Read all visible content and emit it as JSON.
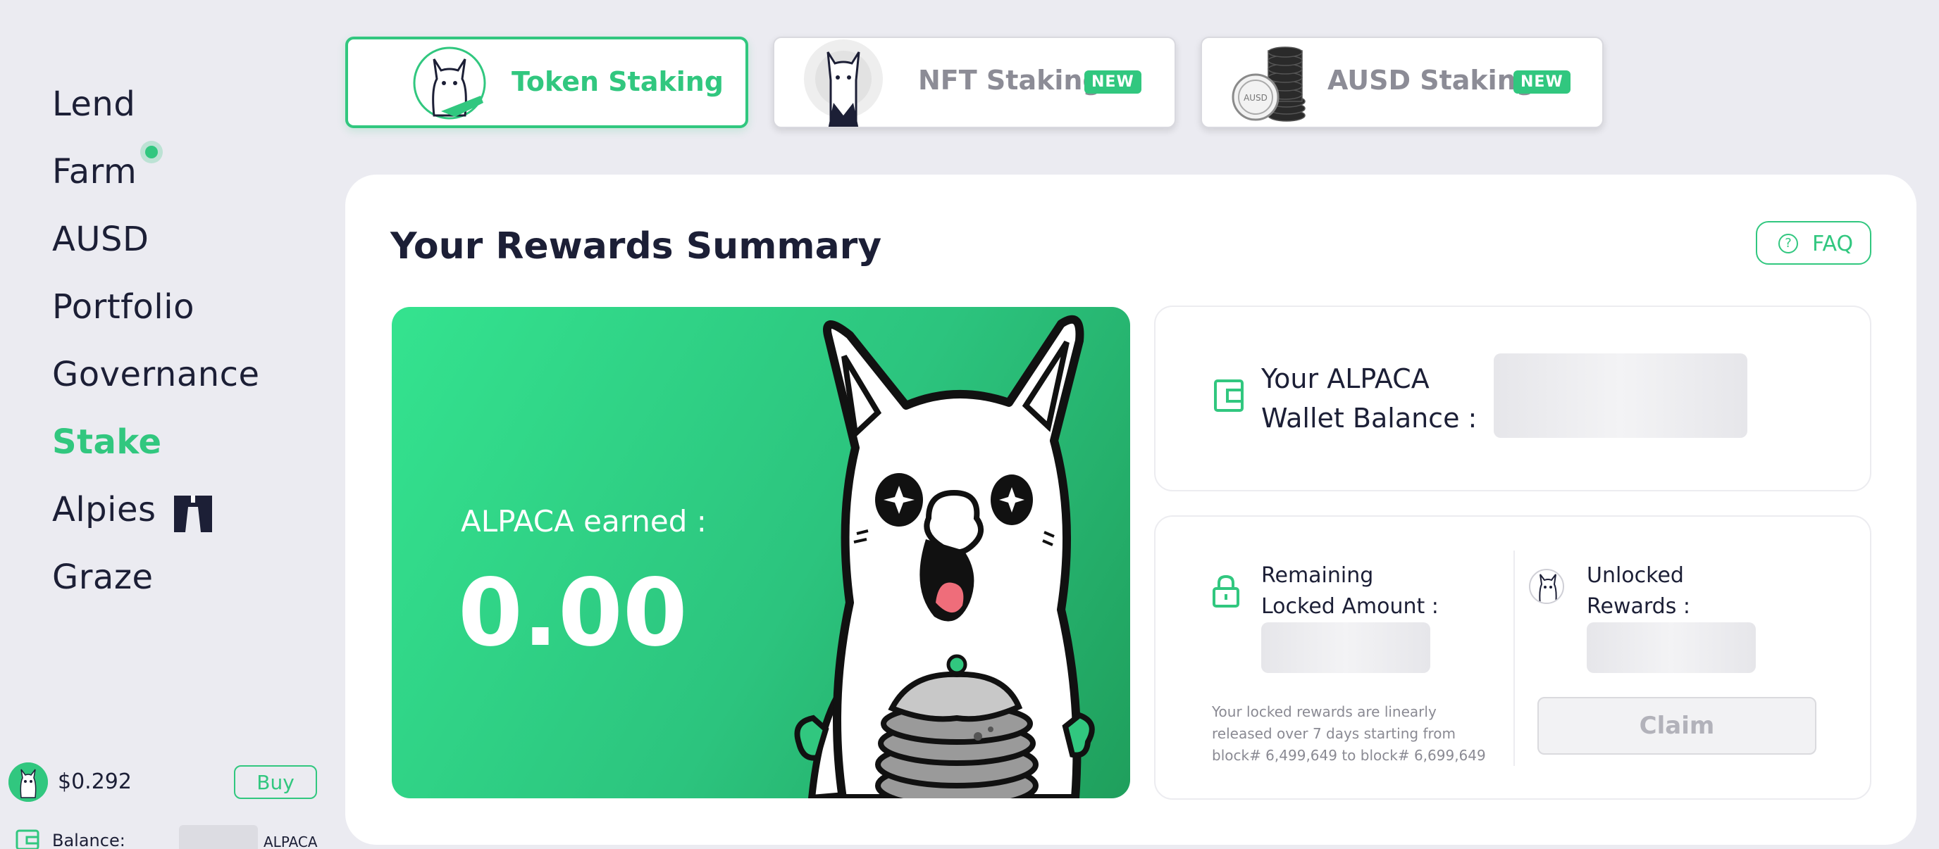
{
  "sidebar": {
    "items": [
      {
        "label": "Lend"
      },
      {
        "label": "Farm"
      },
      {
        "label": "AUSD"
      },
      {
        "label": "Portfolio"
      },
      {
        "label": "Governance"
      },
      {
        "label": "Stake"
      },
      {
        "label": "Alpies"
      },
      {
        "label": "Graze"
      }
    ],
    "active_item": "Stake",
    "price": "$0.292",
    "buy_label": "Buy",
    "balance_label": "Balance:",
    "balance_unit": "ALPACA"
  },
  "tabs": [
    {
      "label": "Token Staking",
      "active": true
    },
    {
      "label": "NFT Staking",
      "badge": "NEW"
    },
    {
      "label": "AUSD Staking",
      "badge": "NEW"
    }
  ],
  "rewards": {
    "title": "Your Rewards Summary",
    "faq_label": "FAQ",
    "earned_label": "ALPACA earned :",
    "earned_value": "0.00",
    "wallet_label": "Your ALPACA Wallet Balance :",
    "locked_label": "Remaining Locked Amount :",
    "unlocked_label": "Unlocked Rewards :",
    "note": "Your locked rewards are linearly released over 7 days starting from block# 6,499,649 to block# 6,699,649",
    "claim_label": "Claim"
  },
  "colors": {
    "accent": "#31c77f",
    "background": "#ebebf1",
    "text": "#1c1f36"
  },
  "icons": [
    "question-circle-icon",
    "wallet-icon",
    "lock-icon",
    "alpaca-avatar-icon",
    "alpies-icon"
  ]
}
